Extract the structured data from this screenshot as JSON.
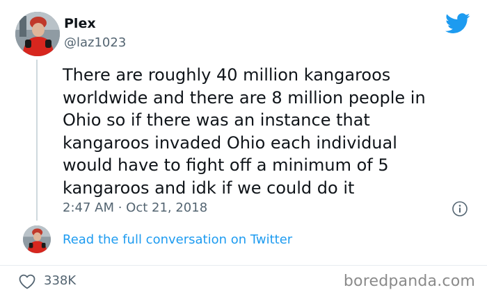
{
  "author": {
    "display_name": "Plex",
    "handle": "@laz1023",
    "avatar": "avatar-photo"
  },
  "tweet": {
    "text": "There are roughly 40 million kangaroos\nworldwide and there are 8 million people in\nOhio so if there was an instance that\nkangaroos invaded Ohio each individual\nwould have to fight off a minimum of 5\nkangaroos and idk if we could do it",
    "timestamp": "2:47 AM · Oct 21, 2018"
  },
  "thread": {
    "read_more_label": "Read the full conversation on Twitter"
  },
  "actions": {
    "like_count": "338K"
  },
  "watermark": "boredpanda.com",
  "icons": {
    "brand": "twitter-bird-icon",
    "info": "info-icon",
    "like": "heart-icon"
  },
  "colors": {
    "twitter_blue": "#1d9bf0",
    "text_primary": "#0f1419",
    "text_secondary": "#536471",
    "thread_line": "#cfd9de"
  }
}
